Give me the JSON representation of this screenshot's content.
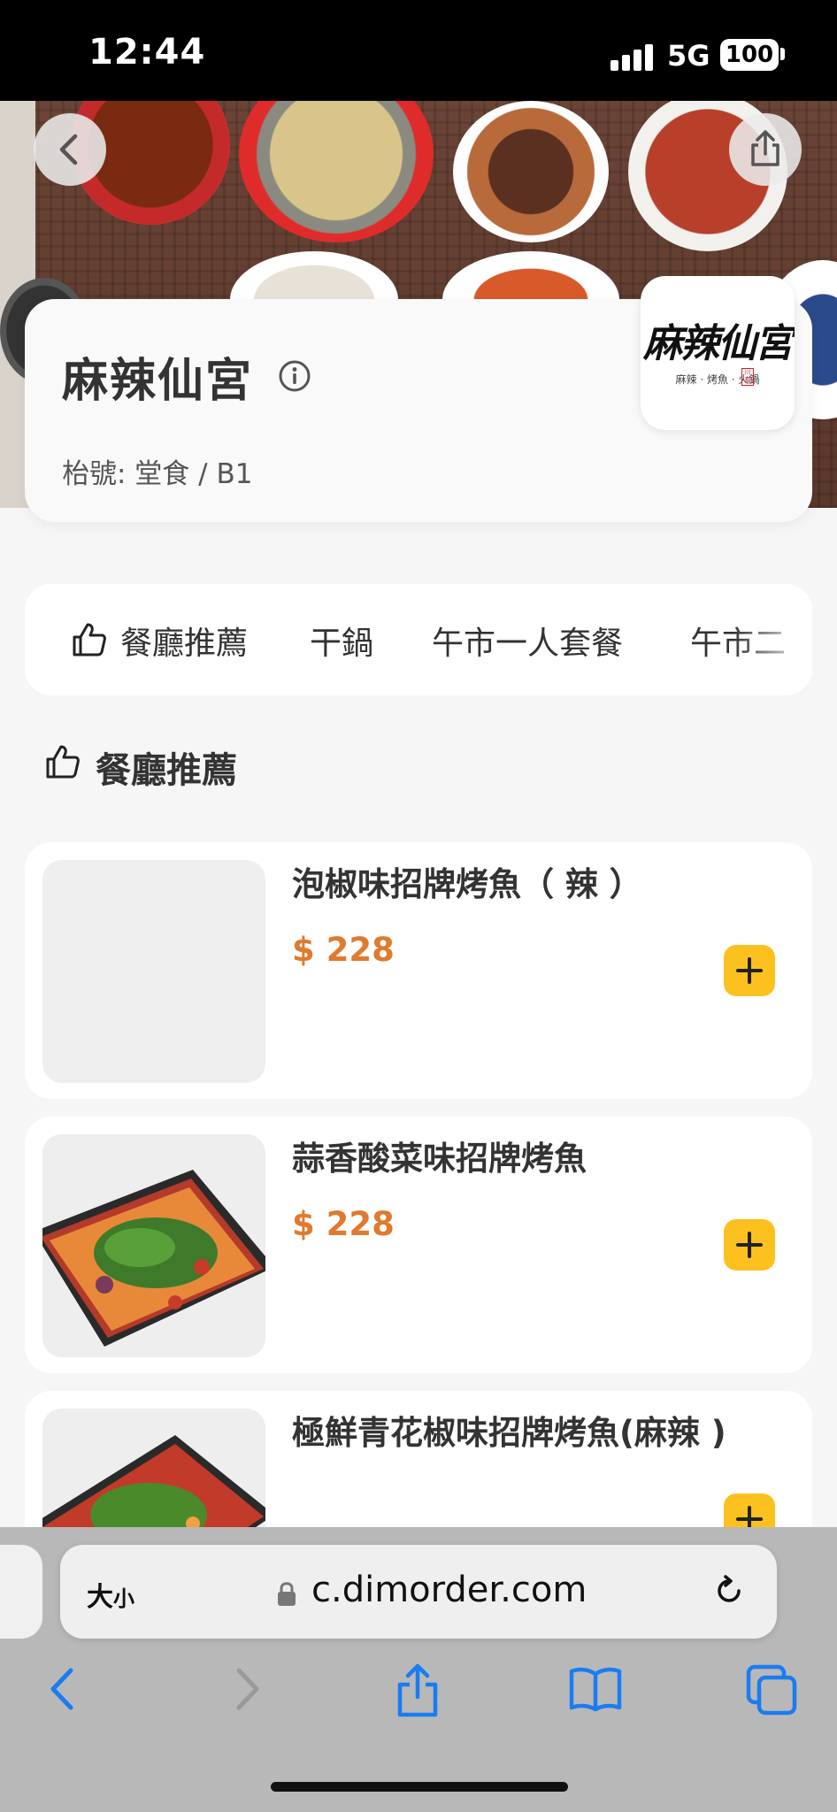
{
  "status_bar": {
    "time": "12:44",
    "network": "5G",
    "battery": "100"
  },
  "restaurant": {
    "name": "麻辣仙宮",
    "table_label": "枱號: 堂食 / B1",
    "logo_text": "麻辣仙宮",
    "logo_subtext": "麻辣 · 烤魚 · 火鍋",
    "logo_seal": "川菜"
  },
  "categories": [
    {
      "label": "餐廳推薦",
      "icon": "thumbs-up-icon"
    },
    {
      "label": "干鍋"
    },
    {
      "label": "午市一人套餐"
    },
    {
      "label": "午市二"
    }
  ],
  "section": {
    "title": "餐廳推薦",
    "icon": "thumbs-up-icon"
  },
  "menu_items": [
    {
      "name": "泡椒味招牌烤魚（ 辣 ）",
      "price": "$ 228",
      "has_image": false
    },
    {
      "name": "蒜香酸菜味招牌烤魚",
      "price": "$ 228",
      "has_image": true
    },
    {
      "name": "極鮮青花椒味招牌烤魚(麻辣 )",
      "price": "",
      "has_image": true
    }
  ],
  "browser": {
    "text_size_label": "大",
    "text_size_small": "小",
    "url": "c.dimorder.com"
  },
  "colors": {
    "accent_price": "#e07a2e",
    "add_button": "#fdc11f",
    "safari_blue": "#1a7cf0"
  }
}
